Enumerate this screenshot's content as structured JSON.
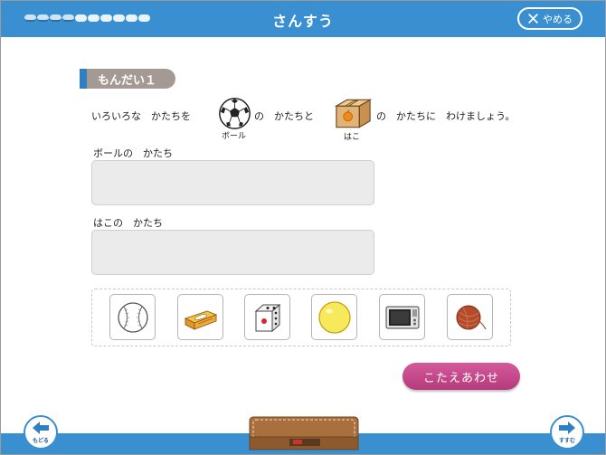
{
  "header": {
    "title": "さんすう",
    "quit_label": "やめる",
    "progress_done": 4,
    "progress_total": 12
  },
  "question": {
    "tag": "もんだい１",
    "text_a": "いろいろな　かたちを",
    "text_b": "の　かたちと",
    "text_c": "の　かたちに　わけましょう。",
    "ball_caption": "ボール",
    "box_caption": "はこ"
  },
  "zones": [
    {
      "label": "ボールの　かたち"
    },
    {
      "label": "はこの　かたち"
    }
  ],
  "cards": [
    {
      "icon": "baseball-icon"
    },
    {
      "icon": "tissue-box-icon"
    },
    {
      "icon": "dice-icon"
    },
    {
      "icon": "yellow-ball-icon"
    },
    {
      "icon": "microwave-icon"
    },
    {
      "icon": "yarn-ball-icon"
    }
  ],
  "actions": {
    "answer_label": "こたえあわせ"
  },
  "footer": {
    "back_label": "もどる",
    "next_label": "すすむ"
  },
  "colors": {
    "bar": "#3a8fd0",
    "answer_button": "#c14a8a",
    "tag": "#a59994"
  }
}
